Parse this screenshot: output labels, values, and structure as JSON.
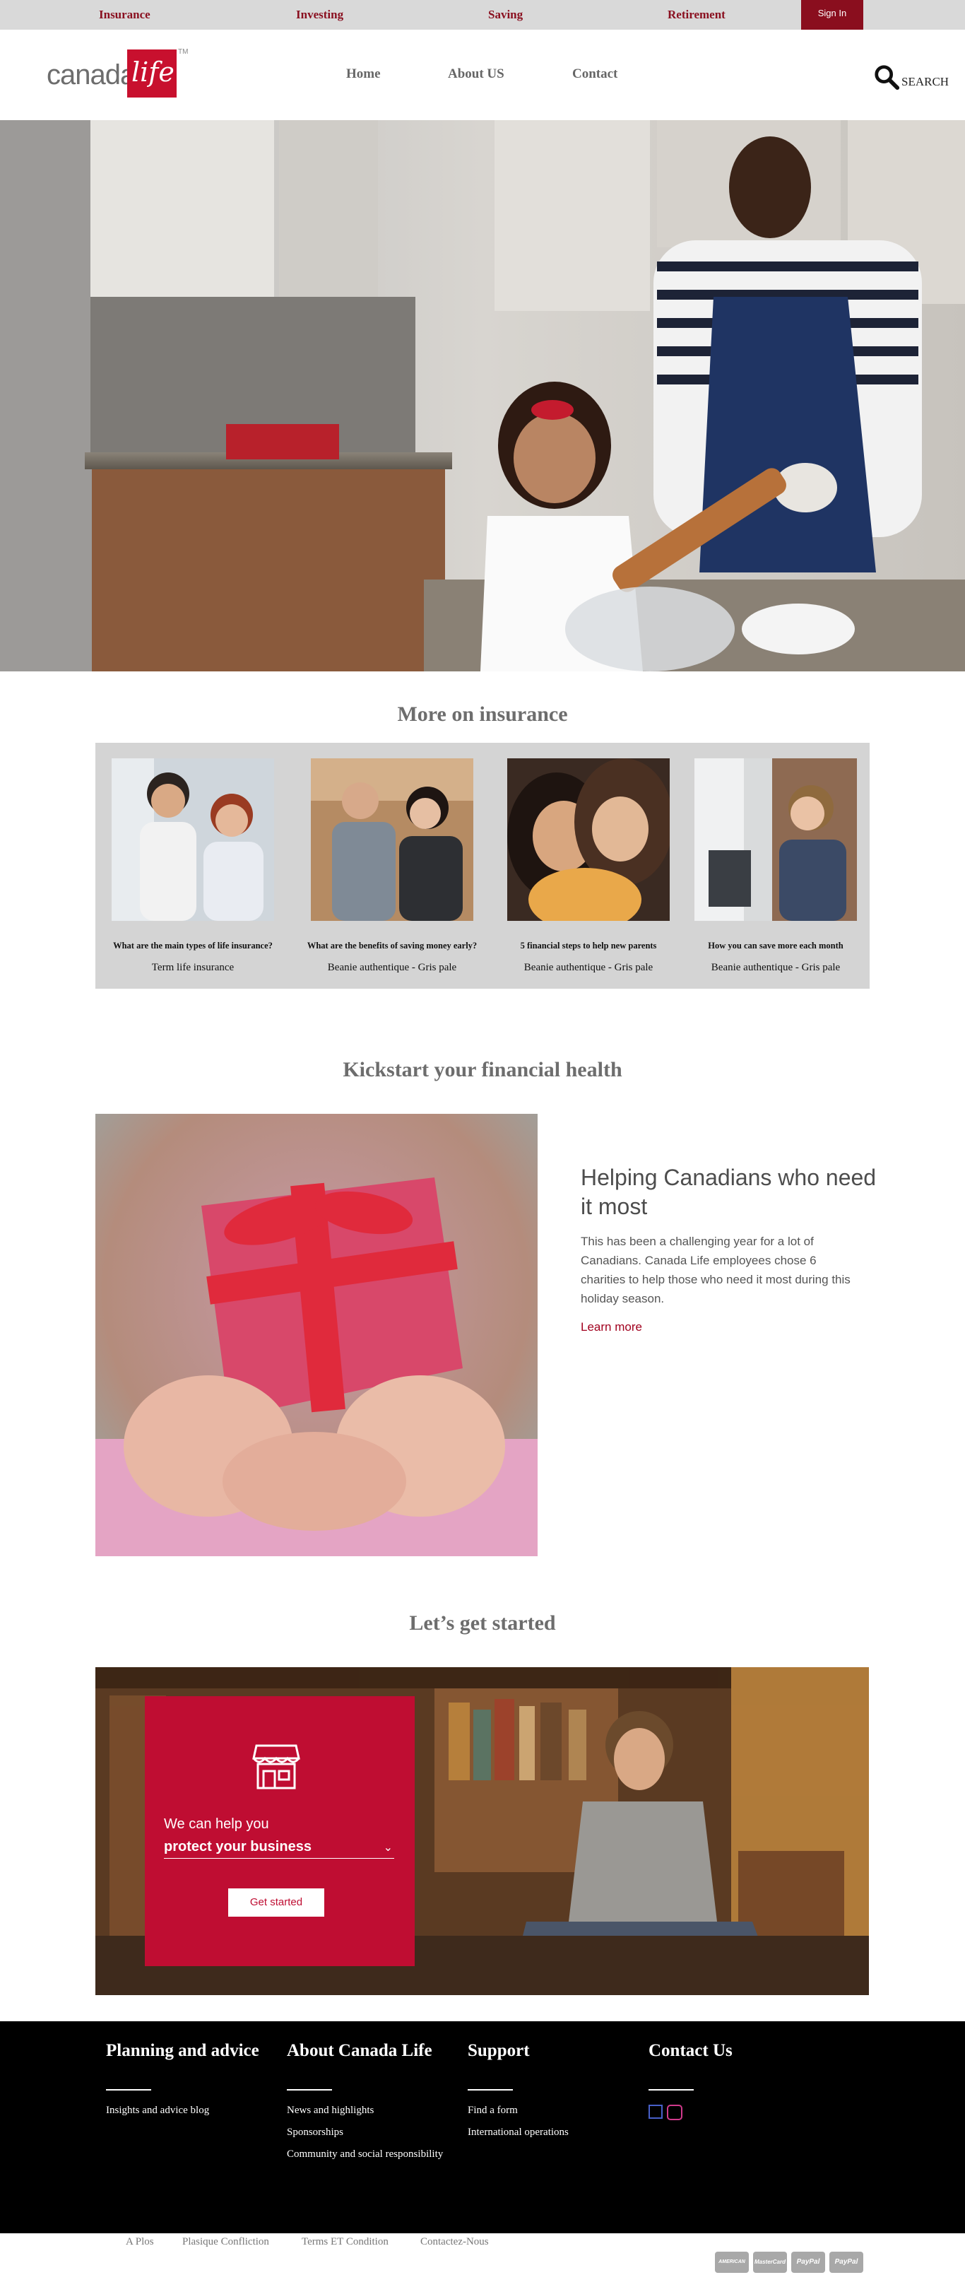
{
  "topbar": {
    "categories": [
      "Insurance",
      "Investing",
      "Saving",
      "Retirement"
    ],
    "signin": "Sign In"
  },
  "header": {
    "logo_canada": "canada",
    "logo_life": "life",
    "logo_tm": "TM",
    "nav": [
      "Home",
      "About US",
      "Contact"
    ],
    "search_label": "SEARCH"
  },
  "insurance": {
    "title": "More on insurance",
    "cards": [
      {
        "question": "What are the main types of life insurance?",
        "desc": "Term life insurance"
      },
      {
        "question": "What are the benefits of saving money early?",
        "desc": "Beanie authentique - Gris pale"
      },
      {
        "question": "5 financial steps to help new parents",
        "desc": "Beanie authentique - Gris pale"
      },
      {
        "question": "How you can save more each month",
        "desc": "Beanie authentique - Gris pale"
      }
    ]
  },
  "kickstart": {
    "title": "Kickstart your financial health",
    "heading": "Helping Canadians who need it most",
    "body": "This has been a challenging year for a lot of Canadians. Canada Life employees chose 6 charities to help those who need it most during this holiday season.",
    "link": "Learn more"
  },
  "started": {
    "title": "Let’s get started",
    "help_text": "We can help you",
    "select_value": "protect your business",
    "button": "Get started"
  },
  "footer": {
    "columns": [
      {
        "title": "Planning and advice",
        "links": [
          "Insights and advice blog"
        ]
      },
      {
        "title": "About Canada Life",
        "links": [
          "News and highlights",
          "Sponsorships",
          "Community and social responsibility"
        ]
      },
      {
        "title": "Support",
        "links": [
          "Find a form",
          "International operations"
        ]
      },
      {
        "title": "Contact Us",
        "links": []
      }
    ],
    "social_icons": [
      "facebook-icon",
      "instagram-icon"
    ]
  },
  "bottombar": {
    "links": [
      "A Plos",
      "Plasique Confliction",
      "Terms ET Condition",
      "Contactez-Nous"
    ],
    "payments": [
      "AMERICAN EXPRESS",
      "MasterCard",
      "PayPal",
      "PayPal"
    ]
  },
  "colors": {
    "brand_red": "#c8102e",
    "signin_bg": "#8a0e1e",
    "topbar_bg": "#d9d9d9",
    "footer_bg": "#000000"
  }
}
